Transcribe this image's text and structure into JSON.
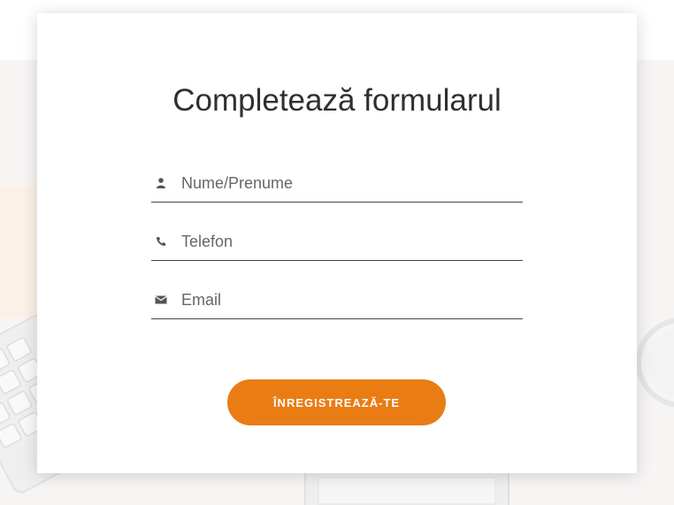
{
  "form": {
    "title": "Completează formularul",
    "fields": [
      {
        "icon": "user-icon",
        "placeholder": "Nume/Prenume",
        "value": ""
      },
      {
        "icon": "phone-icon",
        "placeholder": "Telefon",
        "value": ""
      },
      {
        "icon": "envelope-icon",
        "placeholder": "Email",
        "value": ""
      }
    ],
    "submit_label": "ÎNREGISTREAZĂ-TE"
  },
  "colors": {
    "accent": "#e97d14",
    "background": "#f7f5f4",
    "text": "#2f2f2f"
  }
}
